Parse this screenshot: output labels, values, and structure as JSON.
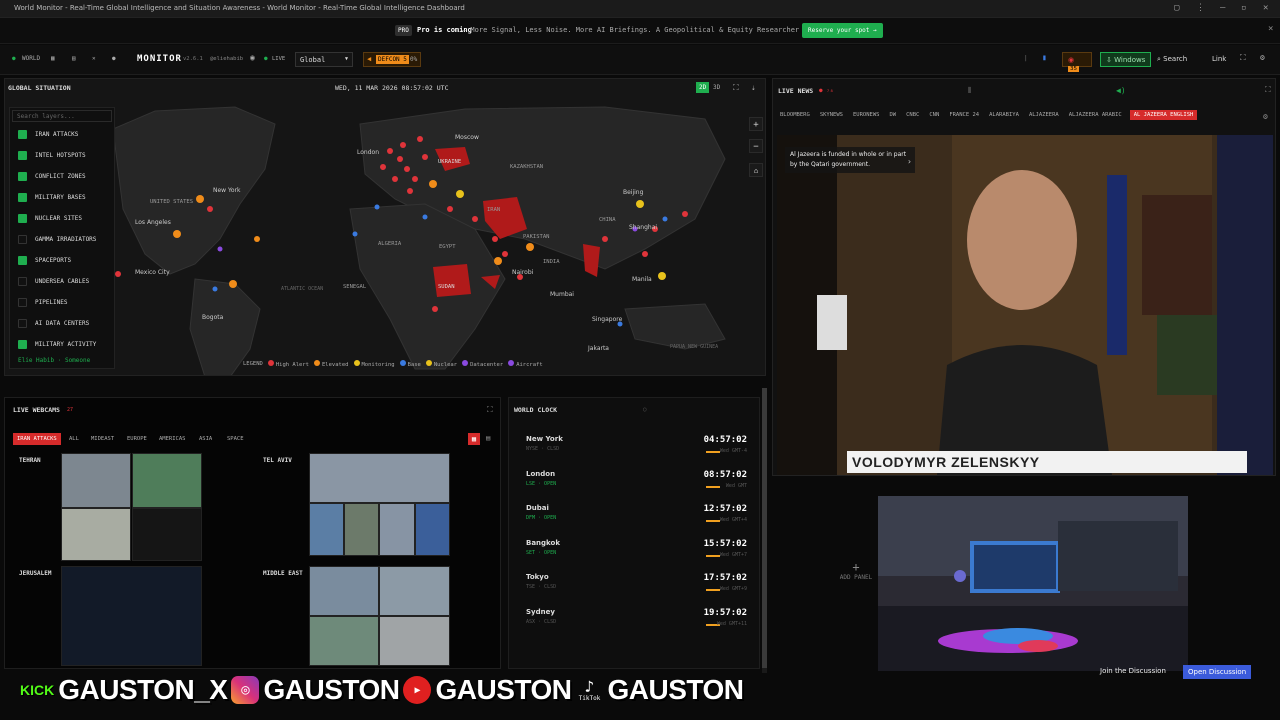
{
  "window": {
    "title": "World Monitor - Real-Time Global Intelligence and Situation Awareness - World Monitor - Real-Time Global Intelligence Dashboard"
  },
  "promo": {
    "badge": "PRO",
    "headline": "Pro is coming",
    "subtext": "— More Signal, Less Noise. More AI Briefings. A Geopolitical & Equity Researcher just for you.",
    "cta": "Reserve your spot →"
  },
  "header": {
    "world": "WORLD",
    "brand": "MONITOR",
    "version": "v2.6.1",
    "handle": "@eliehabib",
    "live": "LIVE",
    "region": "Global",
    "defcon": "DEFCON 5",
    "defcon_pct": "0%",
    "counter": "35",
    "windows_label": "Windows",
    "search_label": "Search",
    "link_label": "Link"
  },
  "map": {
    "title": "GLOBAL SITUATION",
    "datetime": "WED, 11 MAR 2026 08:57:02 UTC",
    "view2d": "2D",
    "view3d": "3D",
    "search_placeholder": "Search layers...",
    "layers": [
      {
        "label": "IRAN ATTACKS",
        "on": true
      },
      {
        "label": "INTEL HOTSPOTS",
        "on": true
      },
      {
        "label": "CONFLICT ZONES",
        "on": true
      },
      {
        "label": "MILITARY BASES",
        "on": true
      },
      {
        "label": "NUCLEAR SITES",
        "on": true
      },
      {
        "label": "GAMMA IRRADIATORS",
        "on": false
      },
      {
        "label": "SPACEPORTS",
        "on": true
      },
      {
        "label": "UNDERSEA CABLES",
        "on": false
      },
      {
        "label": "PIPELINES",
        "on": false
      },
      {
        "label": "AI DATA CENTERS",
        "on": false
      },
      {
        "label": "MILITARY ACTIVITY",
        "on": true
      }
    ],
    "credit": "Elie Habib · Someone",
    "legend": [
      {
        "label": "High Alert",
        "color": "#e0343a"
      },
      {
        "label": "Elevated",
        "color": "#f08c1a"
      },
      {
        "label": "Monitoring",
        "color": "#e8c21c"
      },
      {
        "label": "Base",
        "color": "#3a7ae0"
      },
      {
        "label": "Nuclear",
        "color": "#e8c21c"
      },
      {
        "label": "Datacenter",
        "color": "#8a4ae0"
      },
      {
        "label": "Aircraft",
        "color": "#8a4ae0"
      }
    ],
    "legend_title": "LEGEND",
    "places": [
      "Moscow",
      "London",
      "UKRAINE",
      "KAZAKHSTAN",
      "UNITED STATES",
      "New York",
      "Los Angeles",
      "Mexico City",
      "Bogota",
      "ALGERIA",
      "EGYPT",
      "SUDAN",
      "Nairobi",
      "PAKISTAN",
      "INDIA",
      "CHINA",
      "Beijing",
      "Shanghai",
      "Manila",
      "Singapore",
      "Jakarta",
      "Mumbai",
      "IRAN",
      "SENEGAL",
      "ATLANTIC OCEAN",
      "PAPUA NEW GUINEA"
    ]
  },
  "webcams": {
    "title": "LIVE WEBCAMS",
    "count": "27",
    "tabs": [
      "IRAN ATTACKS",
      "ALL",
      "MIDEAST",
      "EUROPE",
      "AMERICAS",
      "ASIA",
      "SPACE"
    ],
    "cities": [
      "TEHRAN",
      "TEL AVIV",
      "JERUSALEM",
      "MIDDLE EAST"
    ]
  },
  "clock": {
    "title": "WORLD CLOCK",
    "rows": [
      {
        "city": "New York",
        "sub": "NYSE · CLSD",
        "time": "04:57:02",
        "day": "Wed GMT-4",
        "open": false
      },
      {
        "city": "London",
        "sub": "LSE · OPEN",
        "time": "08:57:02",
        "day": "Wed GMT",
        "open": true
      },
      {
        "city": "Dubai",
        "sub": "DFM · OPEN",
        "time": "12:57:02",
        "day": "Wed GMT+4",
        "open": true
      },
      {
        "city": "Bangkok",
        "sub": "SET · OPEN",
        "time": "15:57:02",
        "day": "Wed GMT+7",
        "open": true
      },
      {
        "city": "Tokyo",
        "sub": "TSE · CLSD",
        "time": "17:57:02",
        "day": "Wed GMT+9",
        "open": false
      },
      {
        "city": "Sydney",
        "sub": "ASX · CLSD",
        "time": "19:57:02",
        "day": "Wed GMT+11",
        "open": false
      }
    ]
  },
  "news": {
    "title": "LIVE NEWS",
    "channels": [
      "BLOOMBERG",
      "SKYNEWS",
      "EURONEWS",
      "DW",
      "CNBC",
      "CNN",
      "FRANCE 24",
      "ALARABIYA",
      "ALJAZEERA",
      "ALJAZEERA ARABIC",
      "AL JAZEERA ENGLISH"
    ],
    "notice": "Al Jazeera is funded in whole or in part by the Qatari government.",
    "lower_third": "VOLODYMYR ZELENSKYY"
  },
  "add_panel": "ADD PANEL",
  "socials": [
    {
      "platform": "KICK",
      "handle": "GAUSTON_X"
    },
    {
      "platform": "instagram-icon",
      "handle": "GAUSTON"
    },
    {
      "platform": "youtube-icon",
      "handle": "GAUSTON"
    },
    {
      "platform": "TikTok",
      "handle": "GAUSTON"
    }
  ],
  "discussion": {
    "label": "Join the Discussion",
    "button": "Open Discussion"
  }
}
